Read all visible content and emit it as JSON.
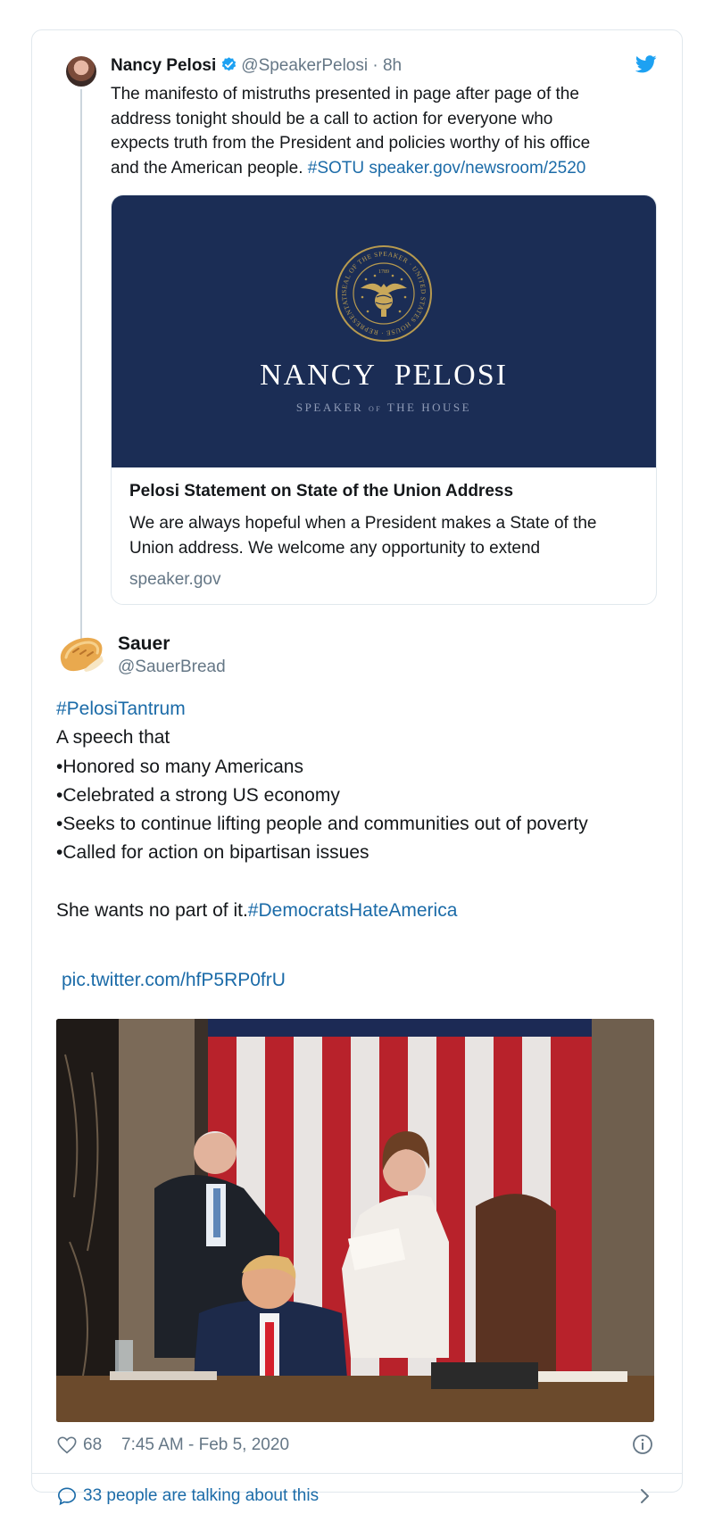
{
  "quoted_tweet": {
    "name": "Nancy Pelosi",
    "handle": "@SpeakerPelosi",
    "separator": "·",
    "time_ago": "8h",
    "text_lines": [
      "The manifesto of mistruths presented in page after page of the",
      "address tonight should be a call to action for everyone who",
      "expects truth from the President and policies worthy of his office",
      "and the American people."
    ],
    "hashtag": "#SOTU",
    "link": "speaker.gov/newsroom/2520",
    "link_card": {
      "image_name": "NANCY  PELOSI",
      "image_subtitle_speaker": "SPEAKER",
      "image_subtitle_of": "OF",
      "image_subtitle_house": "THE HOUSE",
      "seal_caption": "SEAL OF THE SPEAKER · UNITED STATES HOUSE · REPRESENTATIVES",
      "seal_year": "1789",
      "title": "Pelosi Statement on State of the Union Address",
      "description": "We are always hopeful when a President makes a State of the Union address. We welcome any opportunity to extend",
      "domain": "speaker.gov"
    }
  },
  "main_tweet": {
    "name": "Sauer",
    "handle": "@SauerBread",
    "hashtag_top": "#PelosiTantrum",
    "lines": [
      "A speech that",
      "•Honored so many Americans",
      "•Celebrated a strong US economy",
      "•Seeks to continue lifting people and communities out of poverty",
      "•Called for action on bipartisan issues"
    ],
    "closing_text": "She wants no part of it.",
    "closing_hashtag": "#DemocratsHateAmerica",
    "pic_link": "pic.twitter.com/hfP5RP0frU"
  },
  "footer": {
    "likes": "68",
    "timestamp": "7:45 AM - Feb 5, 2020",
    "talking": "33 people are talking about this"
  },
  "colors": {
    "link": "#1b6ba8",
    "muted": "#657786",
    "card_navy": "#1b2d55",
    "verified_blue": "#1da1f2",
    "border": "#e1e8ed"
  }
}
